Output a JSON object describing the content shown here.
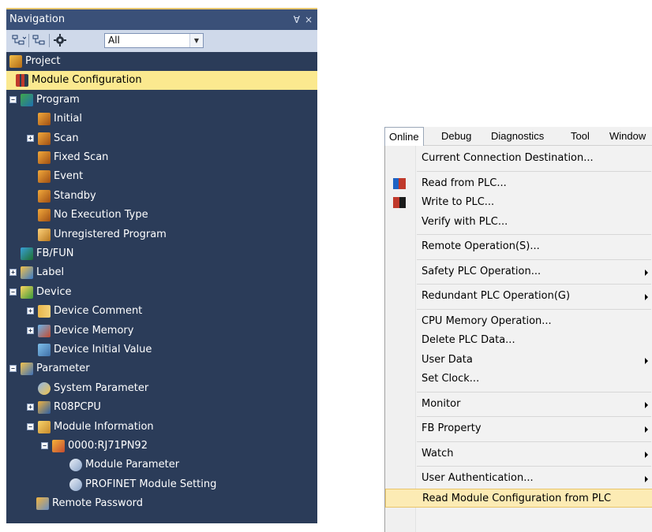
{
  "navigation": {
    "title": "Navigation",
    "pin_glyph": "Ɐ",
    "close_glyph": "×",
    "filter_value": "All",
    "tree": [
      {
        "label": "Project",
        "level": 0,
        "expander": "",
        "icon": "project-icon",
        "iconClass": "ic-project"
      },
      {
        "label": "Module Configuration",
        "level": 1,
        "expander": "",
        "icon": "module-configuration-icon",
        "iconClass": "ic-module",
        "selected": true
      },
      {
        "label": "Program",
        "level": 0,
        "expander": "−",
        "icon": "program-icon",
        "iconClass": "ic-program"
      },
      {
        "label": "Initial",
        "level": 2,
        "expander": "",
        "icon": "program-item-icon",
        "iconClass": "ic-prog-item"
      },
      {
        "label": "Scan",
        "level": 2,
        "expander": "+",
        "icon": "program-item-icon",
        "iconClass": "ic-prog-item"
      },
      {
        "label": "Fixed Scan",
        "level": 2,
        "expander": "",
        "icon": "program-item-icon",
        "iconClass": "ic-prog-item"
      },
      {
        "label": "Event",
        "level": 2,
        "expander": "",
        "icon": "program-item-icon",
        "iconClass": "ic-prog-item"
      },
      {
        "label": "Standby",
        "level": 2,
        "expander": "",
        "icon": "program-item-icon",
        "iconClass": "ic-prog-item"
      },
      {
        "label": "No Execution Type",
        "level": 2,
        "expander": "",
        "icon": "program-item-icon",
        "iconClass": "ic-prog-item"
      },
      {
        "label": "Unregistered Program",
        "level": 2,
        "expander": "",
        "icon": "unregistered-program-icon",
        "iconClass": "ic-unreg"
      },
      {
        "label": "FB/FUN",
        "level": 1,
        "expander": "",
        "icon": "fb-fun-icon",
        "iconClass": "ic-fbfun"
      },
      {
        "label": "Label",
        "level": 0,
        "expander": "+",
        "icon": "label-icon",
        "iconClass": "ic-label"
      },
      {
        "label": "Device",
        "level": 0,
        "expander": "−",
        "icon": "device-icon",
        "iconClass": "ic-device"
      },
      {
        "label": "Device Comment",
        "level": 1,
        "expander": "+",
        "icon": "device-comment-icon",
        "iconClass": "ic-devcomment"
      },
      {
        "label": "Device Memory",
        "level": 1,
        "expander": "+",
        "icon": "device-memory-icon",
        "iconClass": "ic-devmem"
      },
      {
        "label": "Device Initial Value",
        "level": 1,
        "expander": "",
        "icon": "device-initial-value-icon",
        "iconClass": "ic-devinit",
        "nobox": true
      },
      {
        "label": "Parameter",
        "level": 0,
        "expander": "−",
        "icon": "parameter-icon",
        "iconClass": "ic-param"
      },
      {
        "label": "System Parameter",
        "level": 1,
        "expander": "",
        "icon": "system-parameter-icon",
        "iconClass": "ic-syspar",
        "nobox": true
      },
      {
        "label": "R08PCPU",
        "level": 1,
        "expander": "+",
        "icon": "cpu-icon",
        "iconClass": "ic-cpu"
      },
      {
        "label": "Module Information",
        "level": 1,
        "expander": "−",
        "icon": "module-information-icon",
        "iconClass": "ic-modinfo"
      },
      {
        "label": "0000:RJ71PN92",
        "level": 2,
        "expander": "−",
        "icon": "rj71pn92-module-icon",
        "iconClass": "ic-rj"
      },
      {
        "label": "Module Parameter",
        "level": 3,
        "expander": "",
        "icon": "module-parameter-icon",
        "iconClass": "ic-modpar"
      },
      {
        "label": "PROFINET Module Setting",
        "level": 3,
        "expander": "",
        "icon": "profinet-setting-icon",
        "iconClass": "ic-modpar"
      },
      {
        "label": "Remote Password",
        "level": 1,
        "expander": "",
        "icon": "remote-password-icon",
        "iconClass": "ic-remote",
        "nobox": true
      }
    ]
  },
  "menubar": {
    "items": [
      "Online",
      "Debug",
      "Diagnostics",
      "Tool",
      "Window"
    ]
  },
  "online_menu": {
    "items": [
      {
        "label": "Current Connection Destination...",
        "submenu": false
      },
      {
        "separator": true
      },
      {
        "label": "Read from PLC...",
        "submenu": false,
        "icon": "read-from-plc-icon"
      },
      {
        "label": "Write to PLC...",
        "submenu": false,
        "icon": "write-to-plc-icon"
      },
      {
        "label": "Verify with PLC...",
        "submenu": false
      },
      {
        "separator": true
      },
      {
        "label": "Remote Operation(S)...",
        "submenu": false
      },
      {
        "separator": true
      },
      {
        "label": "Safety PLC Operation...",
        "submenu": true
      },
      {
        "separator": true
      },
      {
        "label": "Redundant PLC Operation(G)",
        "submenu": true
      },
      {
        "separator": true
      },
      {
        "label": "CPU Memory Operation...",
        "submenu": false
      },
      {
        "label": "Delete PLC Data...",
        "submenu": false
      },
      {
        "label": "User Data",
        "submenu": true
      },
      {
        "label": "Set Clock...",
        "submenu": false
      },
      {
        "separator": true
      },
      {
        "label": "Monitor",
        "submenu": true
      },
      {
        "separator": true
      },
      {
        "label": "FB Property",
        "submenu": true
      },
      {
        "separator": true
      },
      {
        "label": "Watch",
        "submenu": true
      },
      {
        "separator": true
      },
      {
        "label": "User Authentication...",
        "submenu": true
      },
      {
        "label": "Read Module Configuration from PLC",
        "submenu": false,
        "highlight": true
      }
    ]
  }
}
